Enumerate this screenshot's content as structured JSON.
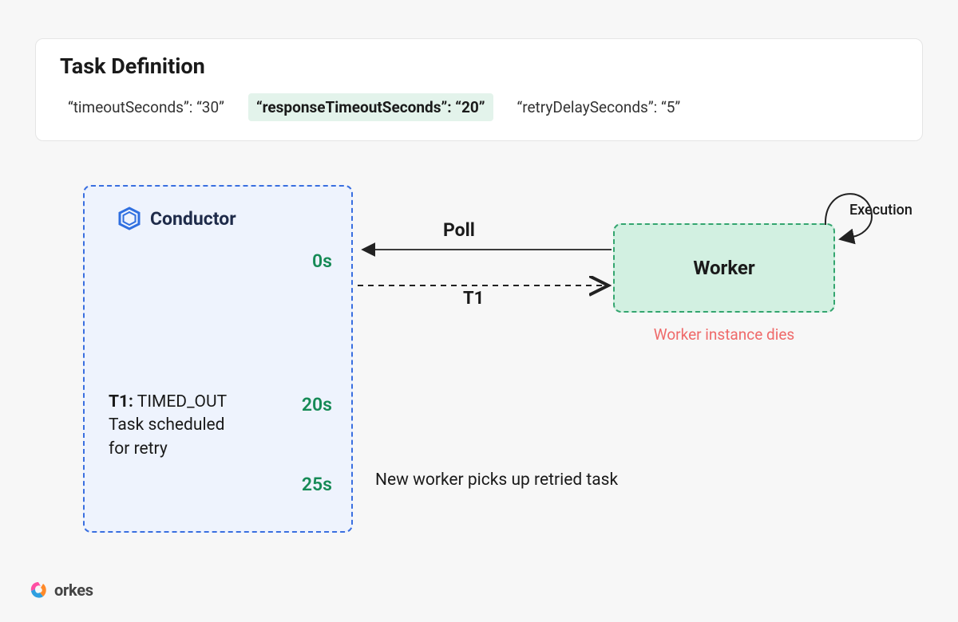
{
  "taskDefinition": {
    "title": "Task Definition",
    "params": {
      "timeout": "“timeoutSeconds”: “30”",
      "responseTimeout": "“responseTimeoutSeconds”: “20”",
      "retryDelay": "“retryDelaySeconds”: “5”"
    }
  },
  "conductor": {
    "name": "Conductor",
    "times": {
      "t0": "0s",
      "t20": "20s",
      "t25": "25s"
    },
    "status": {
      "prefix": "T1:",
      "state": " TIMED_OUT",
      "line2": "Task scheduled",
      "line3": "for retry"
    }
  },
  "arrows": {
    "poll": "Poll",
    "t1": "T1",
    "execution": "Execution"
  },
  "worker": {
    "label": "Worker",
    "diesText": "Worker instance dies",
    "newWorkerText": "New worker picks up retried task"
  },
  "footer": {
    "brand": "orkes"
  }
}
